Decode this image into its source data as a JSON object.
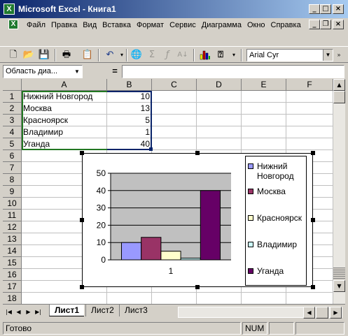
{
  "window": {
    "title": "Microsoft Excel - Книга1",
    "controls": {
      "minimize": "_",
      "maximize": "□",
      "close": "×"
    },
    "doc_controls": {
      "minimize": "_",
      "restore": "❐",
      "close": "×"
    }
  },
  "menu": {
    "items": [
      {
        "label": "Файл"
      },
      {
        "label": "Правка"
      },
      {
        "label": "Вид"
      },
      {
        "label": "Вставка"
      },
      {
        "label": "Формат"
      },
      {
        "label": "Сервис"
      },
      {
        "label": "Диаграмма"
      },
      {
        "label": "Окно"
      },
      {
        "label": "Справка"
      }
    ]
  },
  "toolbar": {
    "font_name": "Arial Cyr",
    "buttons": [
      {
        "icon": "new-icon"
      },
      {
        "icon": "open-icon"
      },
      {
        "icon": "save-icon"
      },
      {
        "icon": "print-icon"
      },
      {
        "icon": "paste-icon"
      },
      {
        "icon": "undo-icon"
      },
      {
        "icon": "hyperlink-icon"
      },
      {
        "icon": "autosum-icon"
      },
      {
        "icon": "function-icon"
      },
      {
        "icon": "sort-icon"
      },
      {
        "icon": "chart-wizard-icon"
      },
      {
        "icon": "help-icon"
      }
    ]
  },
  "formula_bar": {
    "name_box": "Область диа...",
    "equals": "=",
    "value": ""
  },
  "grid": {
    "columns": [
      "A",
      "B",
      "C",
      "D",
      "E",
      "F"
    ],
    "rows": [
      "1",
      "2",
      "3",
      "4",
      "5",
      "6",
      "7",
      "8",
      "9",
      "10",
      "11",
      "12",
      "13",
      "14",
      "15",
      "16",
      "17",
      "18"
    ],
    "data": [
      {
        "name": "Нижний Новгород",
        "value": "10"
      },
      {
        "name": "Москва",
        "value": "13"
      },
      {
        "name": "Красноярск",
        "value": "5"
      },
      {
        "name": "Владимир",
        "value": "1"
      },
      {
        "name": "Уганда",
        "value": "40"
      }
    ]
  },
  "chart_data": {
    "type": "bar",
    "categories": [
      "1"
    ],
    "series": [
      {
        "name": "Нижний Новгород",
        "values": [
          10
        ],
        "color": "#9999ff"
      },
      {
        "name": "Москва",
        "values": [
          13
        ],
        "color": "#993366"
      },
      {
        "name": "Красноярск",
        "values": [
          5
        ],
        "color": "#ffffcc"
      },
      {
        "name": "Владимир",
        "values": [
          1
        ],
        "color": "#ccffff"
      },
      {
        "name": "Уганда",
        "values": [
          40
        ],
        "color": "#660066"
      }
    ],
    "yticks": [
      "0",
      "10",
      "20",
      "30",
      "40",
      "50"
    ],
    "ylim": [
      0,
      50
    ],
    "plot_background": "#c0c0c0",
    "grid": true,
    "legend": "right",
    "title": "",
    "xlabel": "",
    "ylabel": ""
  },
  "sheet_tabs": {
    "tabs": [
      {
        "label": "Лист1",
        "active": true
      },
      {
        "label": "Лист2",
        "active": false
      },
      {
        "label": "Лист3",
        "active": false
      }
    ]
  },
  "status": {
    "ready": "Готово",
    "num": "NUM"
  }
}
